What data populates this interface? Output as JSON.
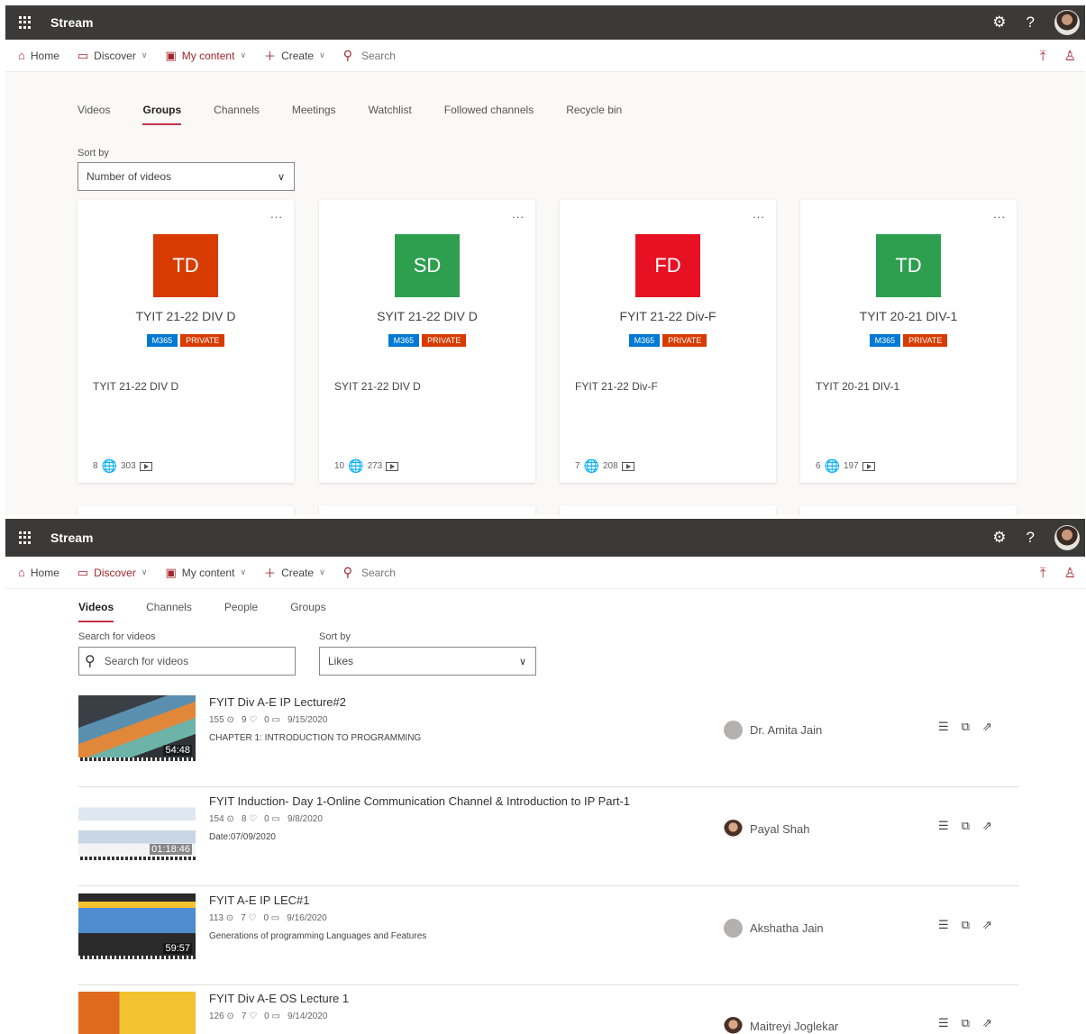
{
  "app": {
    "name": "Stream"
  },
  "nav": {
    "home": "Home",
    "discover": "Discover",
    "my_content": "My content",
    "create": "Create",
    "search_placeholder": "Search"
  },
  "screen1": {
    "tabs": [
      "Videos",
      "Groups",
      "Channels",
      "Meetings",
      "Watchlist",
      "Followed channels",
      "Recycle bin"
    ],
    "active_tab": "Groups",
    "sort_label": "Sort by",
    "sort_value": "Number of videos",
    "more": "...",
    "badge_m365": "M365",
    "badge_private": "PRIVATE",
    "groups": [
      {
        "initials": "TD",
        "color": "#d83b01",
        "name": "TYIT 21-22 DIV D",
        "description": "TYIT 21-22 DIV D",
        "members": "8",
        "videos": "303"
      },
      {
        "initials": "SD",
        "color": "#2e9e4f",
        "name": "SYIT 21-22 DIV D",
        "description": "SYIT 21-22 DIV D",
        "members": "10",
        "videos": "273"
      },
      {
        "initials": "FD",
        "color": "#e81123",
        "name": "FYIT 21-22 Div-F",
        "description": "FYIT 21-22 Div-F",
        "members": "7",
        "videos": "208"
      },
      {
        "initials": "TD",
        "color": "#2e9e4f",
        "name": "TYIT 20-21 DIV-1",
        "description": "TYIT 20-21 DIV-1",
        "members": "6",
        "videos": "197"
      }
    ]
  },
  "screen2": {
    "tabs": [
      "Videos",
      "Channels",
      "People",
      "Groups"
    ],
    "active_tab": "Videos",
    "search_label": "Search for videos",
    "search_placeholder": "Search for videos",
    "sort_label": "Sort by",
    "sort_value": "Likes",
    "videos": [
      {
        "title": "FYIT Div A-E IP Lecture#2",
        "views": "155",
        "likes": "9",
        "comments": "0",
        "date": "9/15/2020",
        "description": "CHAPTER 1: INTRODUCTION TO PROGRAMMING",
        "duration": "54:48",
        "owner": "Dr. Amita Jain",
        "owner_photo": false
      },
      {
        "title": "FYIT Induction- Day 1-Online Communication Channel & Introduction to IP Part-1",
        "views": "154",
        "likes": "8",
        "comments": "0",
        "date": "9/8/2020",
        "description": "Date:07/09/2020",
        "duration": "01:18:46",
        "owner": "Payal Shah",
        "owner_photo": true
      },
      {
        "title": "FYIT A-E IP LEC#1",
        "views": "113",
        "likes": "7",
        "comments": "0",
        "date": "9/16/2020",
        "description": "Generations of programming Languages and Features",
        "duration": "59:57",
        "owner": "Akshatha Jain",
        "owner_photo": false
      },
      {
        "title": "FYIT Div A-E OS Lecture 1",
        "views": "126",
        "likes": "7",
        "comments": "0",
        "date": "9/14/2020",
        "description": "",
        "duration": "",
        "owner": "Maitreyi Joglekar",
        "owner_photo": true
      }
    ]
  }
}
